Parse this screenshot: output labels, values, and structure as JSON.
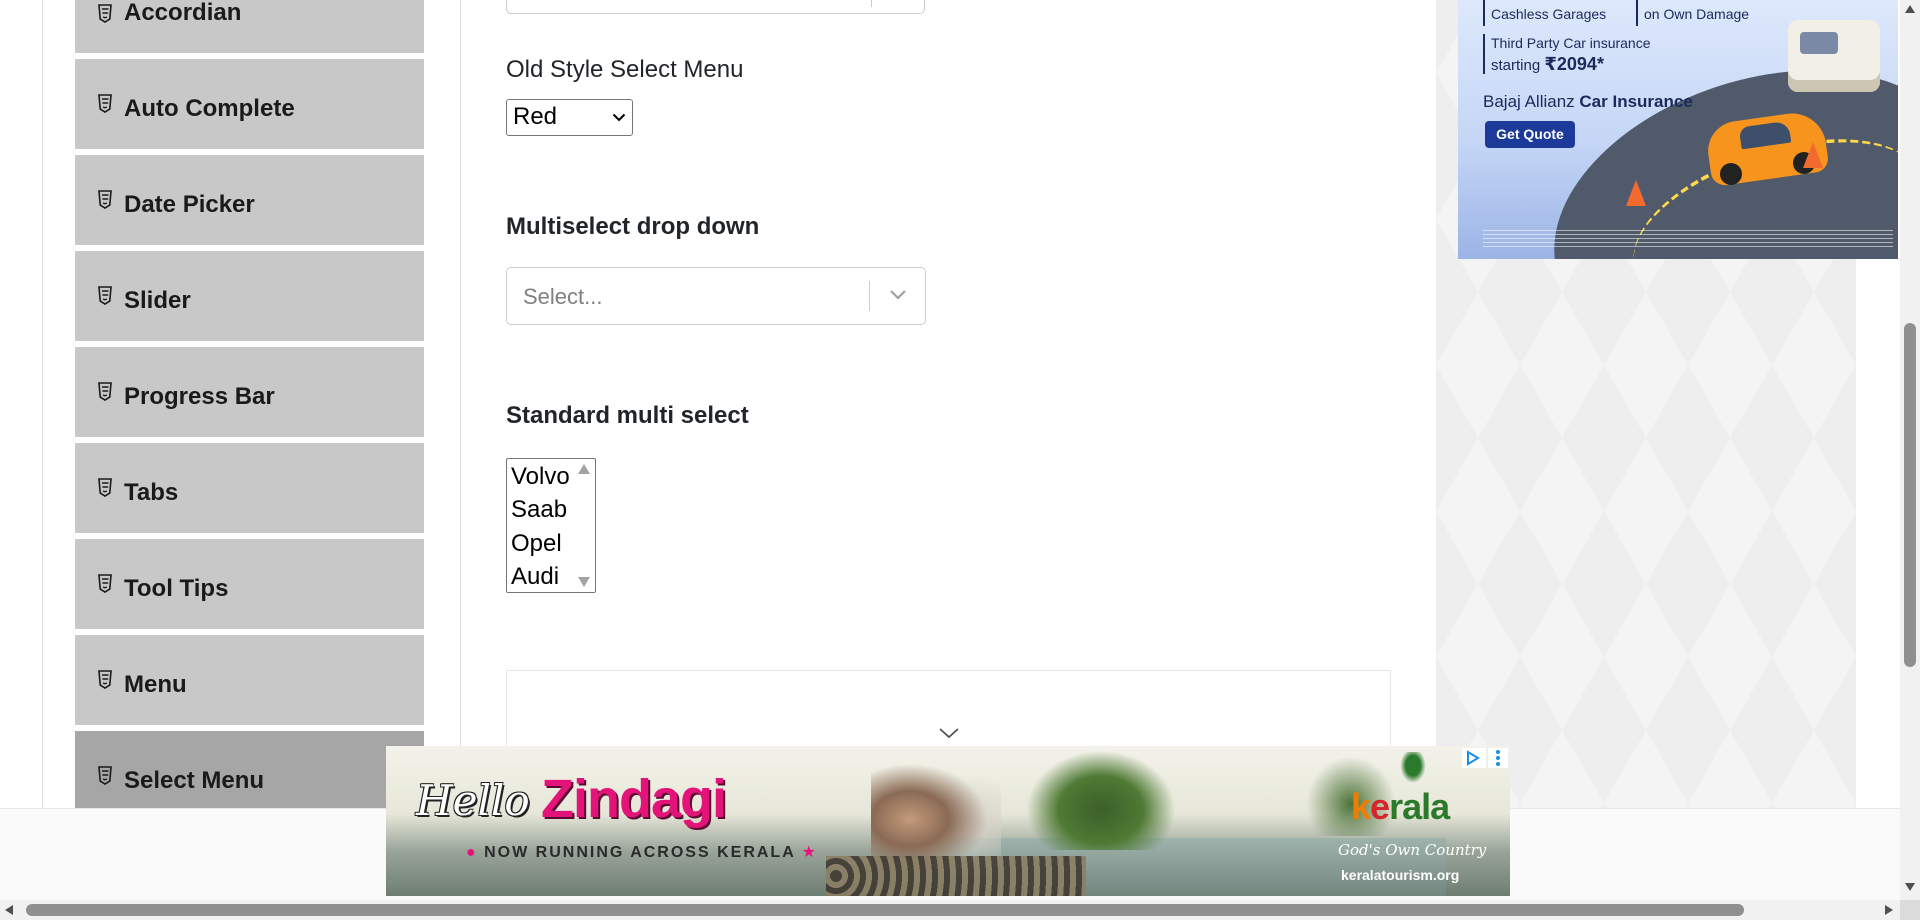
{
  "sidebar": {
    "items": [
      {
        "label": "Accordian",
        "active": false
      },
      {
        "label": "Auto Complete",
        "active": false
      },
      {
        "label": "Date Picker",
        "active": false
      },
      {
        "label": "Slider",
        "active": false
      },
      {
        "label": "Progress Bar",
        "active": false
      },
      {
        "label": "Tabs",
        "active": false
      },
      {
        "label": "Tool Tips",
        "active": false
      },
      {
        "label": "Menu",
        "active": false
      },
      {
        "label": "Select Menu",
        "active": true
      }
    ],
    "item_icon": "html5-doc-icon"
  },
  "main": {
    "old_select": {
      "heading": "Old Style Select Menu",
      "selected_value": "Red"
    },
    "multiselect": {
      "heading": "Multiselect drop down",
      "placeholder": "Select..."
    },
    "standard_multi": {
      "heading": "Standard multi select",
      "options": [
        "Volvo",
        "Saab",
        "Opel",
        "Audi"
      ]
    }
  },
  "ads": {
    "insurance": {
      "line_1": "Cashless Garages",
      "line_2": "on Own Damage",
      "line_3a": "Third Party Car insurance",
      "line_3b": "starting",
      "price": "₹2094*",
      "brand_plain": "Bajaj Allianz",
      "brand_bold": "Car Insurance",
      "cta": "Get Quote"
    },
    "banner": {
      "hello": "Hello",
      "headline": "Zindagi",
      "tagline": "NOW RUNNING ACROSS KERALA",
      "logo_parts": [
        "k",
        "e",
        "rala"
      ],
      "slogan": "God's Own Country",
      "url": "keralatourism.org"
    }
  },
  "colors": {
    "sidebar_item_bg": "#c8c8c8",
    "sidebar_active_bg": "#a6a6a6",
    "ad_accent_pink": "#e4137a",
    "quote_button": "#1c3a9a"
  },
  "icons": {
    "scroll_up": "triangle-up-icon",
    "scroll_down": "triangle-down-icon",
    "dropdown": "chevron-down-icon",
    "ad_choices": "adchoices-icon",
    "ad_menu": "kebab-menu-icon"
  }
}
